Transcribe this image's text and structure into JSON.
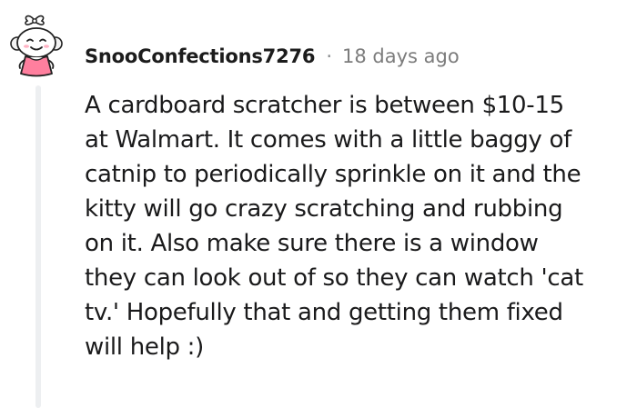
{
  "comment": {
    "author": "SnooConfections7276",
    "separator": "·",
    "age": "18 days ago",
    "body_lines": [
      "A cardboard scratcher is between $10-15",
      "at Walmart. It comes with a little baggy of",
      "catnip to periodically sprinkle on it and the",
      "kitty will go crazy scratching and rubbing",
      "on it. Also make sure there is a window",
      "they can look out of so they can watch 'cat",
      "tv.' Hopefully that and getting them fixed",
      "will help :)"
    ]
  },
  "colors": {
    "username": "#1c1c1c",
    "timestamp": "#7c7c7c",
    "thread_line": "#edeff1",
    "avatar_dress": "#ff7f9e",
    "avatar_hair": "#f2f2f2"
  },
  "icons": {
    "avatar": "snoo-avatar-icon"
  }
}
